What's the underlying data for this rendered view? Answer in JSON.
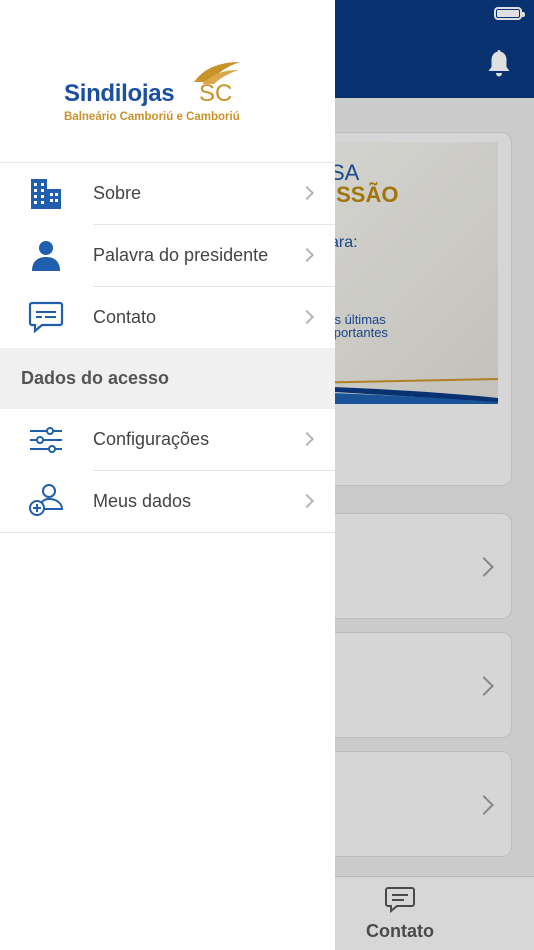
{
  "drawer": {
    "logo": {
      "brand": "Sindilojas",
      "brand_suffix": "SC",
      "subtitle": "Balneário Camboriú e Camboriú"
    },
    "menu": [
      {
        "label": "Sobre",
        "icon": "building-icon"
      },
      {
        "label": "Palavra do presidente",
        "icon": "person-icon"
      },
      {
        "label": "Contato",
        "icon": "chat-icon"
      }
    ],
    "section_title": "Dados do acesso",
    "section_menu": [
      {
        "label": "Configurações",
        "icon": "sliders-icon"
      },
      {
        "label": "Meus dados",
        "icon": "add-user-icon"
      }
    ]
  },
  "background": {
    "banner": {
      "line1": "SA",
      "line2": "ISSÃO",
      "line3": "ara:",
      "line4": "das últimas",
      "line5": "importantes"
    },
    "tabbar": {
      "active_tab": "Contato"
    }
  },
  "colors": {
    "header_blue": "#0a3a80",
    "icon_blue": "#1f5fad",
    "accent_gold": "#c8932a"
  }
}
